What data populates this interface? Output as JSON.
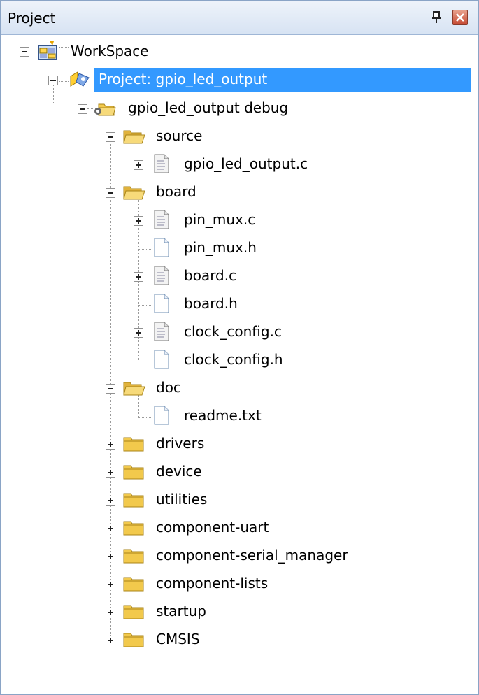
{
  "panel": {
    "title": "Project"
  },
  "tree": {
    "workspace": "WorkSpace",
    "project": "Project: gpio_led_output",
    "target": "gpio_led_output debug",
    "source": {
      "label": "source",
      "files": [
        "gpio_led_output.c"
      ]
    },
    "board": {
      "label": "board",
      "files": [
        "pin_mux.c",
        "pin_mux.h",
        "board.c",
        "board.h",
        "clock_config.c",
        "clock_config.h"
      ]
    },
    "doc": {
      "label": "doc",
      "files": [
        "readme.txt"
      ]
    },
    "folders": [
      "drivers",
      "device",
      "utilities",
      "component-uart",
      "component-serial_manager",
      "component-lists",
      "startup",
      "CMSIS"
    ]
  },
  "colors": {
    "selection": "#3399ff",
    "folder": "#f2c94c"
  }
}
